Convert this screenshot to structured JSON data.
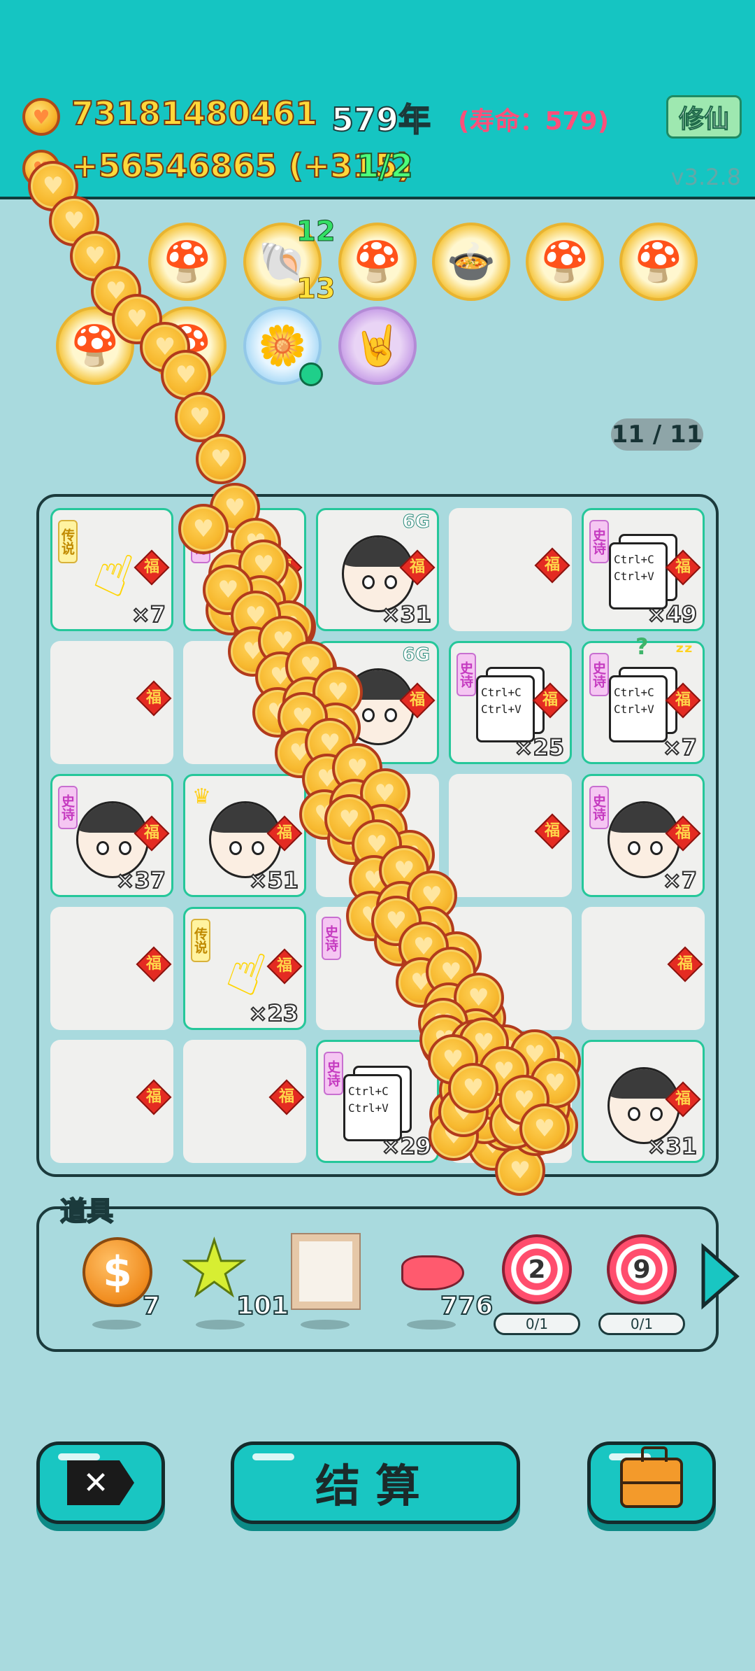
{
  "header": {
    "coins": "73181480461",
    "year": "579年",
    "lifespan": "(寿命：579)",
    "income": "+56546865 (+315)",
    "progress": "1/2",
    "cultivate_label": "修仙",
    "version": "v3.2.8"
  },
  "slots": [
    {
      "icon": "mushroom-cloud-icon"
    },
    {
      "icon": "seashell-icon",
      "top_count": "12",
      "bottom_count": "13"
    },
    {
      "icon": "mushroom-cloud-icon"
    },
    {
      "icon": "rice-cooker-duck-icon"
    },
    {
      "icon": "mushroom-cloud-icon"
    },
    {
      "icon": "mushroom-cloud-icon"
    },
    {
      "icon": "mushroom-cloud-icon"
    },
    {
      "icon": "mushroom-cloud-icon"
    },
    {
      "icon": "potted-flower-icon"
    },
    {
      "icon": "rock-hand-icon"
    }
  ],
  "board": {
    "counter": "11 / 11",
    "fu_label": "福",
    "tag_legend": "传说",
    "tag_epic": "史诗",
    "badge_6g": "6G",
    "ctrl_c": "Ctrl+C",
    "ctrl_v": "Ctrl+V",
    "cells": [
      {
        "count": "×7"
      },
      {
        "count": "×31"
      },
      {
        "count": "×49"
      },
      {
        "count": "×25"
      },
      {
        "count": "×7"
      },
      {
        "count": "×37"
      },
      {
        "count": "×51"
      },
      {
        "count": "×7"
      },
      {
        "count": "×23"
      },
      {
        "count": "×29"
      },
      {
        "count": "×31"
      }
    ]
  },
  "props": {
    "title": "道具",
    "items": [
      {
        "icon": "dollar-coin-icon",
        "count": "7"
      },
      {
        "icon": "star-icon",
        "count": "101"
      },
      {
        "icon": "frame-icon",
        "count": ""
      },
      {
        "icon": "liver-icon",
        "count": "776"
      },
      {
        "icon": "target-icon",
        "label": "2",
        "ratio": "0/1"
      },
      {
        "icon": "target-icon",
        "label": "9",
        "ratio": "0/1"
      }
    ]
  },
  "buttons": {
    "settle": "结算",
    "delete_icon": "delete-icon",
    "bag_icon": "briefcase-icon"
  },
  "colors": {
    "header_bg": "#15c5c2",
    "page_bg": "#a9dade",
    "coin": "#f7b92f"
  }
}
